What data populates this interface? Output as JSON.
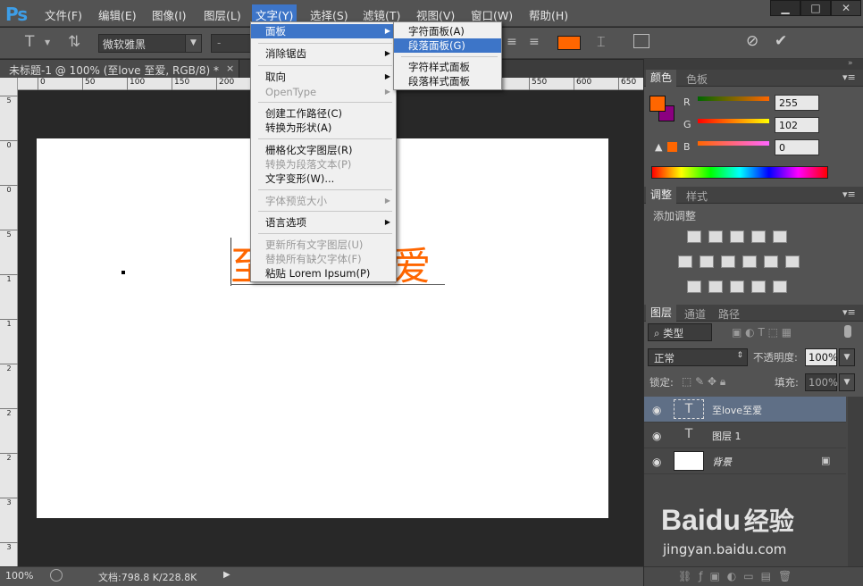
{
  "app": {
    "logo": "Ps",
    "accent": "#3d75c8"
  },
  "menubar": {
    "items": [
      "文件(F)",
      "编辑(E)",
      "图像(I)",
      "图层(L)",
      "文字(Y)",
      "选择(S)",
      "滤镜(T)",
      "视图(V)",
      "窗口(W)",
      "帮助(H)"
    ],
    "active": "文字(Y)",
    "window_buttons": [
      "▁",
      "□",
      "✕"
    ]
  },
  "options": {
    "font_family": "微软雅黑",
    "font_style": "-",
    "text_color": "#ff6600"
  },
  "document": {
    "tab_title": "未标题-1 @ 100% (至love 至爱, RGB/8) *",
    "close": "×",
    "zoom": "100%",
    "doc_size": "文档:798.8 K/228.8K",
    "canvas_text": "至love至爱"
  },
  "rulers": {
    "h": [
      "0",
      "50",
      "100",
      "150",
      "200",
      "250",
      "300",
      "350",
      "400",
      "450",
      "500",
      "550",
      "600",
      "650"
    ],
    "v": [
      "5",
      "0",
      "0",
      "5",
      "1",
      "1",
      "2",
      "2",
      "2",
      "3",
      "3",
      "4",
      "4"
    ]
  },
  "type_menu": {
    "items": [
      {
        "label": "面板",
        "submenu": true,
        "highlight": true
      },
      {
        "label": "消除锯齿",
        "submenu": true
      },
      {
        "label": "取向",
        "submenu": true
      },
      {
        "label": "OpenType",
        "submenu": true,
        "disabled": true
      },
      {
        "label": "创建工作路径(C)"
      },
      {
        "label": "转换为形状(A)"
      },
      {
        "label": "栅格化文字图层(R)"
      },
      {
        "label": "转换为段落文本(P)",
        "disabled": true
      },
      {
        "label": "文字变形(W)..."
      },
      {
        "label": "字体预览大小",
        "submenu": true,
        "disabled": true
      },
      {
        "label": "语言选项",
        "submenu": true
      },
      {
        "label": "更新所有文字图层(U)",
        "disabled": true
      },
      {
        "label": "替换所有缺欠字体(F)",
        "disabled": true
      },
      {
        "label": "粘贴 Lorem Ipsum(P)"
      }
    ]
  },
  "panel_submenu": {
    "items": [
      "字符面板(A)",
      "段落面板(G)",
      "字符样式面板",
      "段落样式面板"
    ],
    "highlight": "段落面板(G)"
  },
  "color_panel": {
    "tabs": [
      "颜色",
      "色板"
    ],
    "r": "255",
    "g": "102",
    "b": "0",
    "r_label": "R",
    "g_label": "G",
    "b_label": "B",
    "fg": "#ff6600",
    "bg": "#8b0080"
  },
  "adjust_panel": {
    "tabs": [
      "调整",
      "样式"
    ],
    "title": "添加调整"
  },
  "layers_panel": {
    "tabs": [
      "图层",
      "通道",
      "路径"
    ],
    "kind": "类型",
    "blend": "正常",
    "opacity_label": "不透明度:",
    "opacity": "100%",
    "lock_label": "锁定:",
    "fill_label": "填充:",
    "fill": "100%",
    "layers": [
      {
        "name": "至love至爱",
        "type": "text",
        "selected": true
      },
      {
        "name": "图层 1",
        "type": "text"
      },
      {
        "name": "背景",
        "type": "bg",
        "locked": true
      }
    ]
  },
  "watermark": {
    "brand": "Baidu",
    "brand2": "经验",
    "url": "jingyan.baidu.com"
  }
}
